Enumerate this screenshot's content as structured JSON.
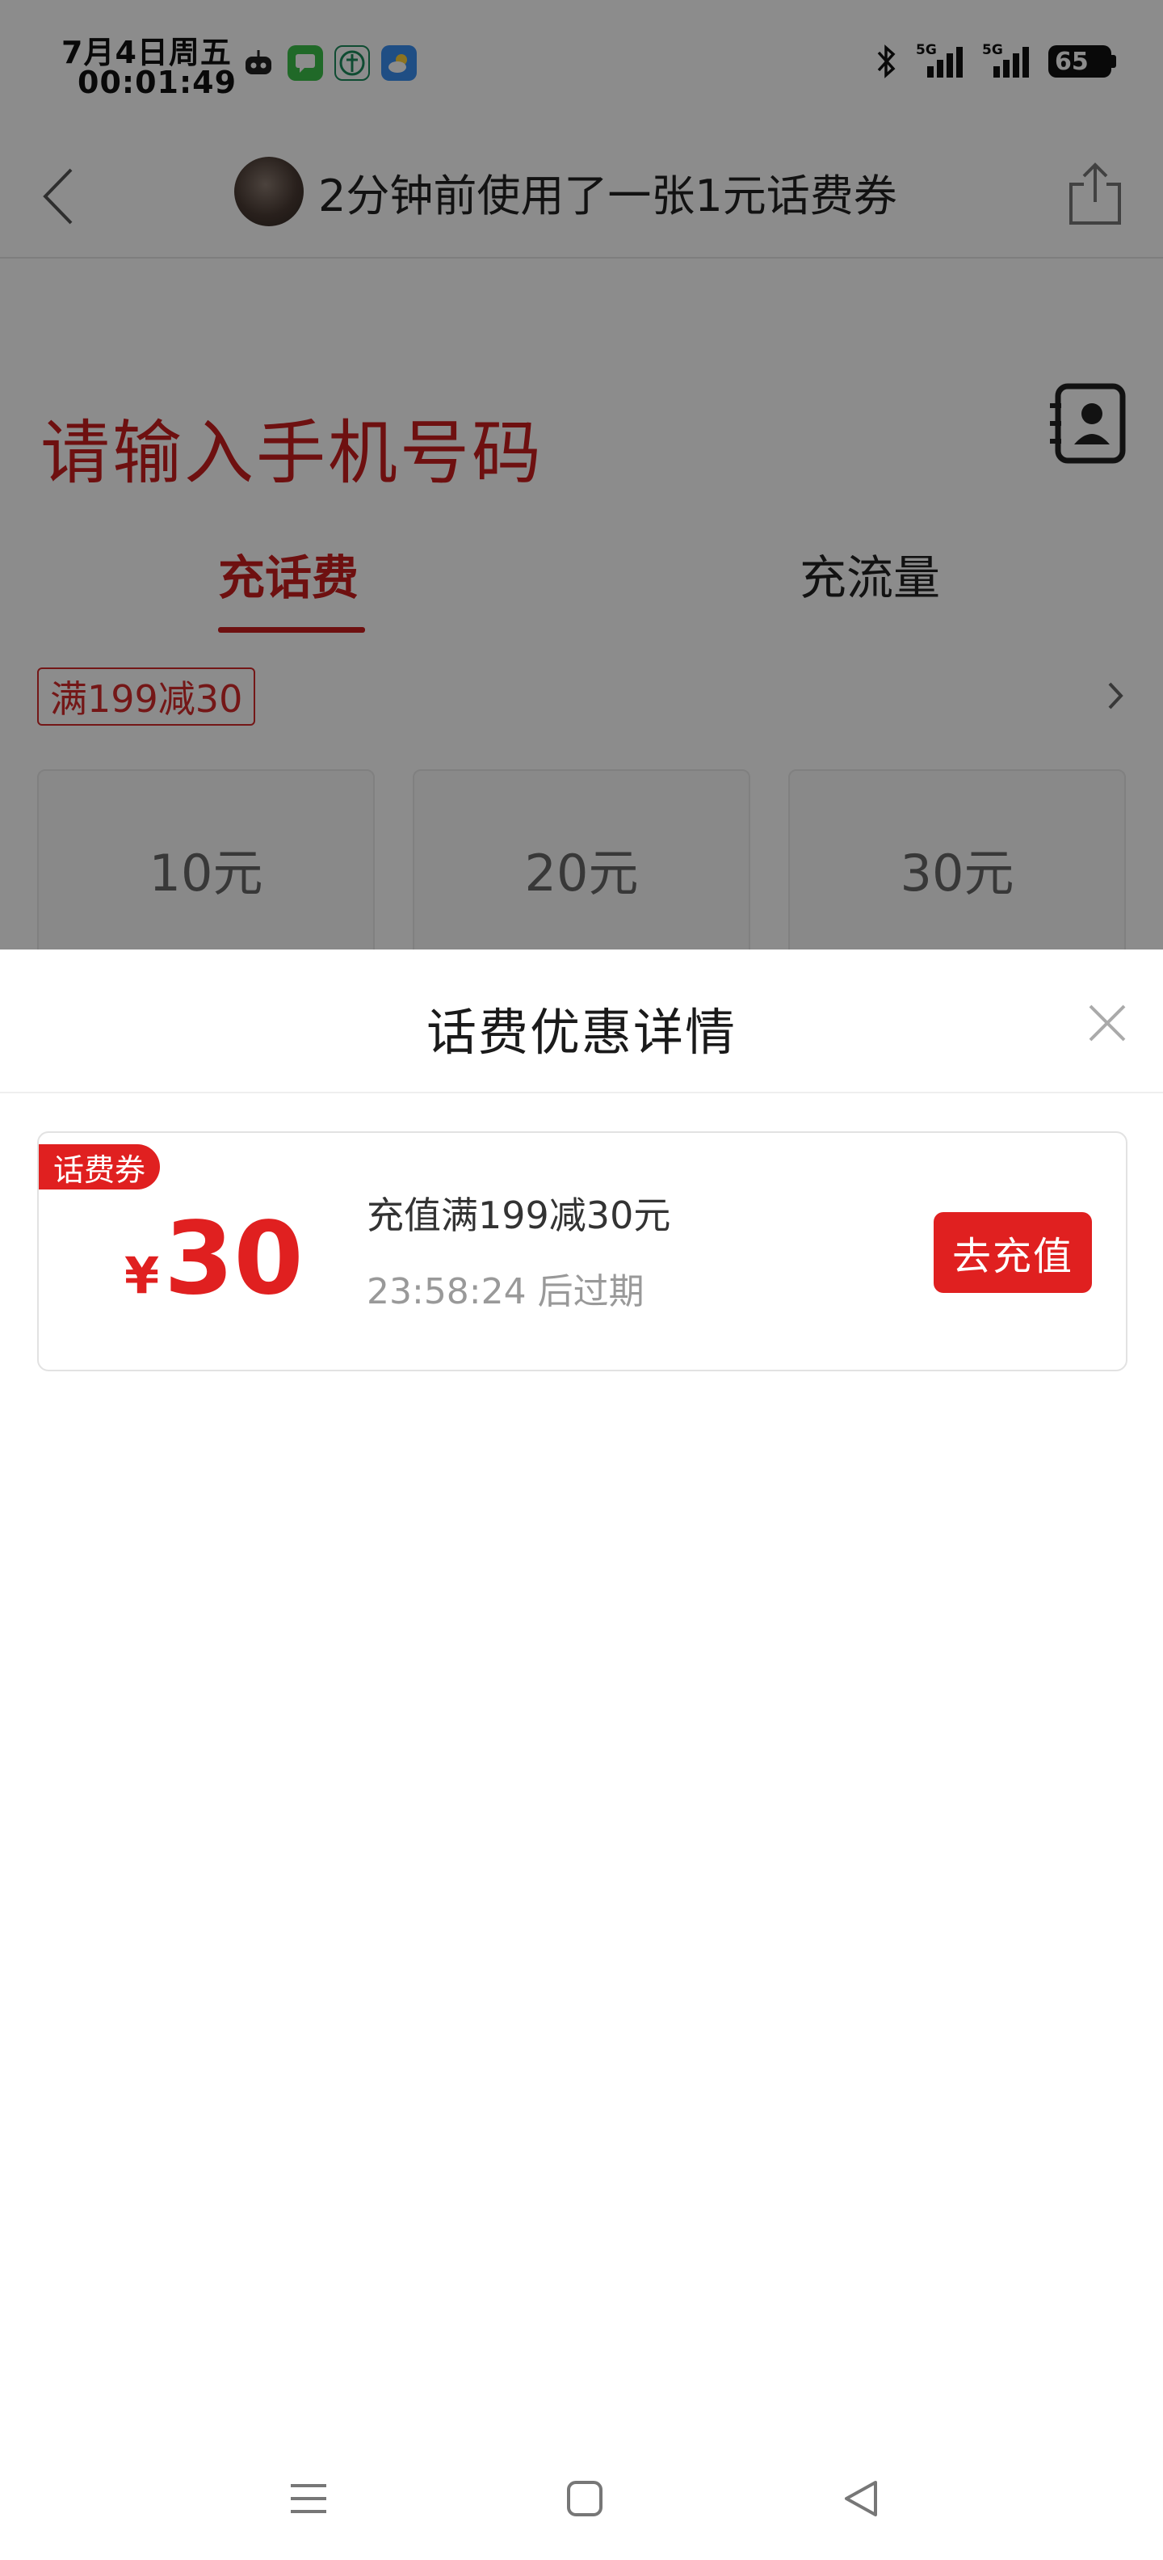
{
  "status_bar": {
    "date": "7月4日周五",
    "time": "00:01:49",
    "app_icons": [
      "robot-icon",
      "message-icon",
      "bank-icon",
      "weather-icon"
    ],
    "signal_1_label": "5G",
    "signal_2_label": "5G",
    "battery": "65"
  },
  "nav": {
    "title": "2分钟前使用了一张1元话费券"
  },
  "recharge": {
    "phone_placeholder": "请输入手机号码",
    "tabs": [
      {
        "label": "充话费",
        "active": true
      },
      {
        "label": "充流量",
        "active": false
      }
    ],
    "promo_tag": "满199减30",
    "amounts": [
      "10元",
      "20元",
      "30元"
    ]
  },
  "sheet": {
    "title": "话费优惠详情",
    "coupon": {
      "badge": "话费券",
      "currency": "¥",
      "value": "30",
      "description": "充值满199减30元",
      "expiry": "23:58:24 后过期",
      "button": "去充值"
    }
  },
  "colors": {
    "accent": "#e02020",
    "prompt_red": "#c81e1e",
    "overlay": "rgba(0,0,0,0.45)"
  }
}
